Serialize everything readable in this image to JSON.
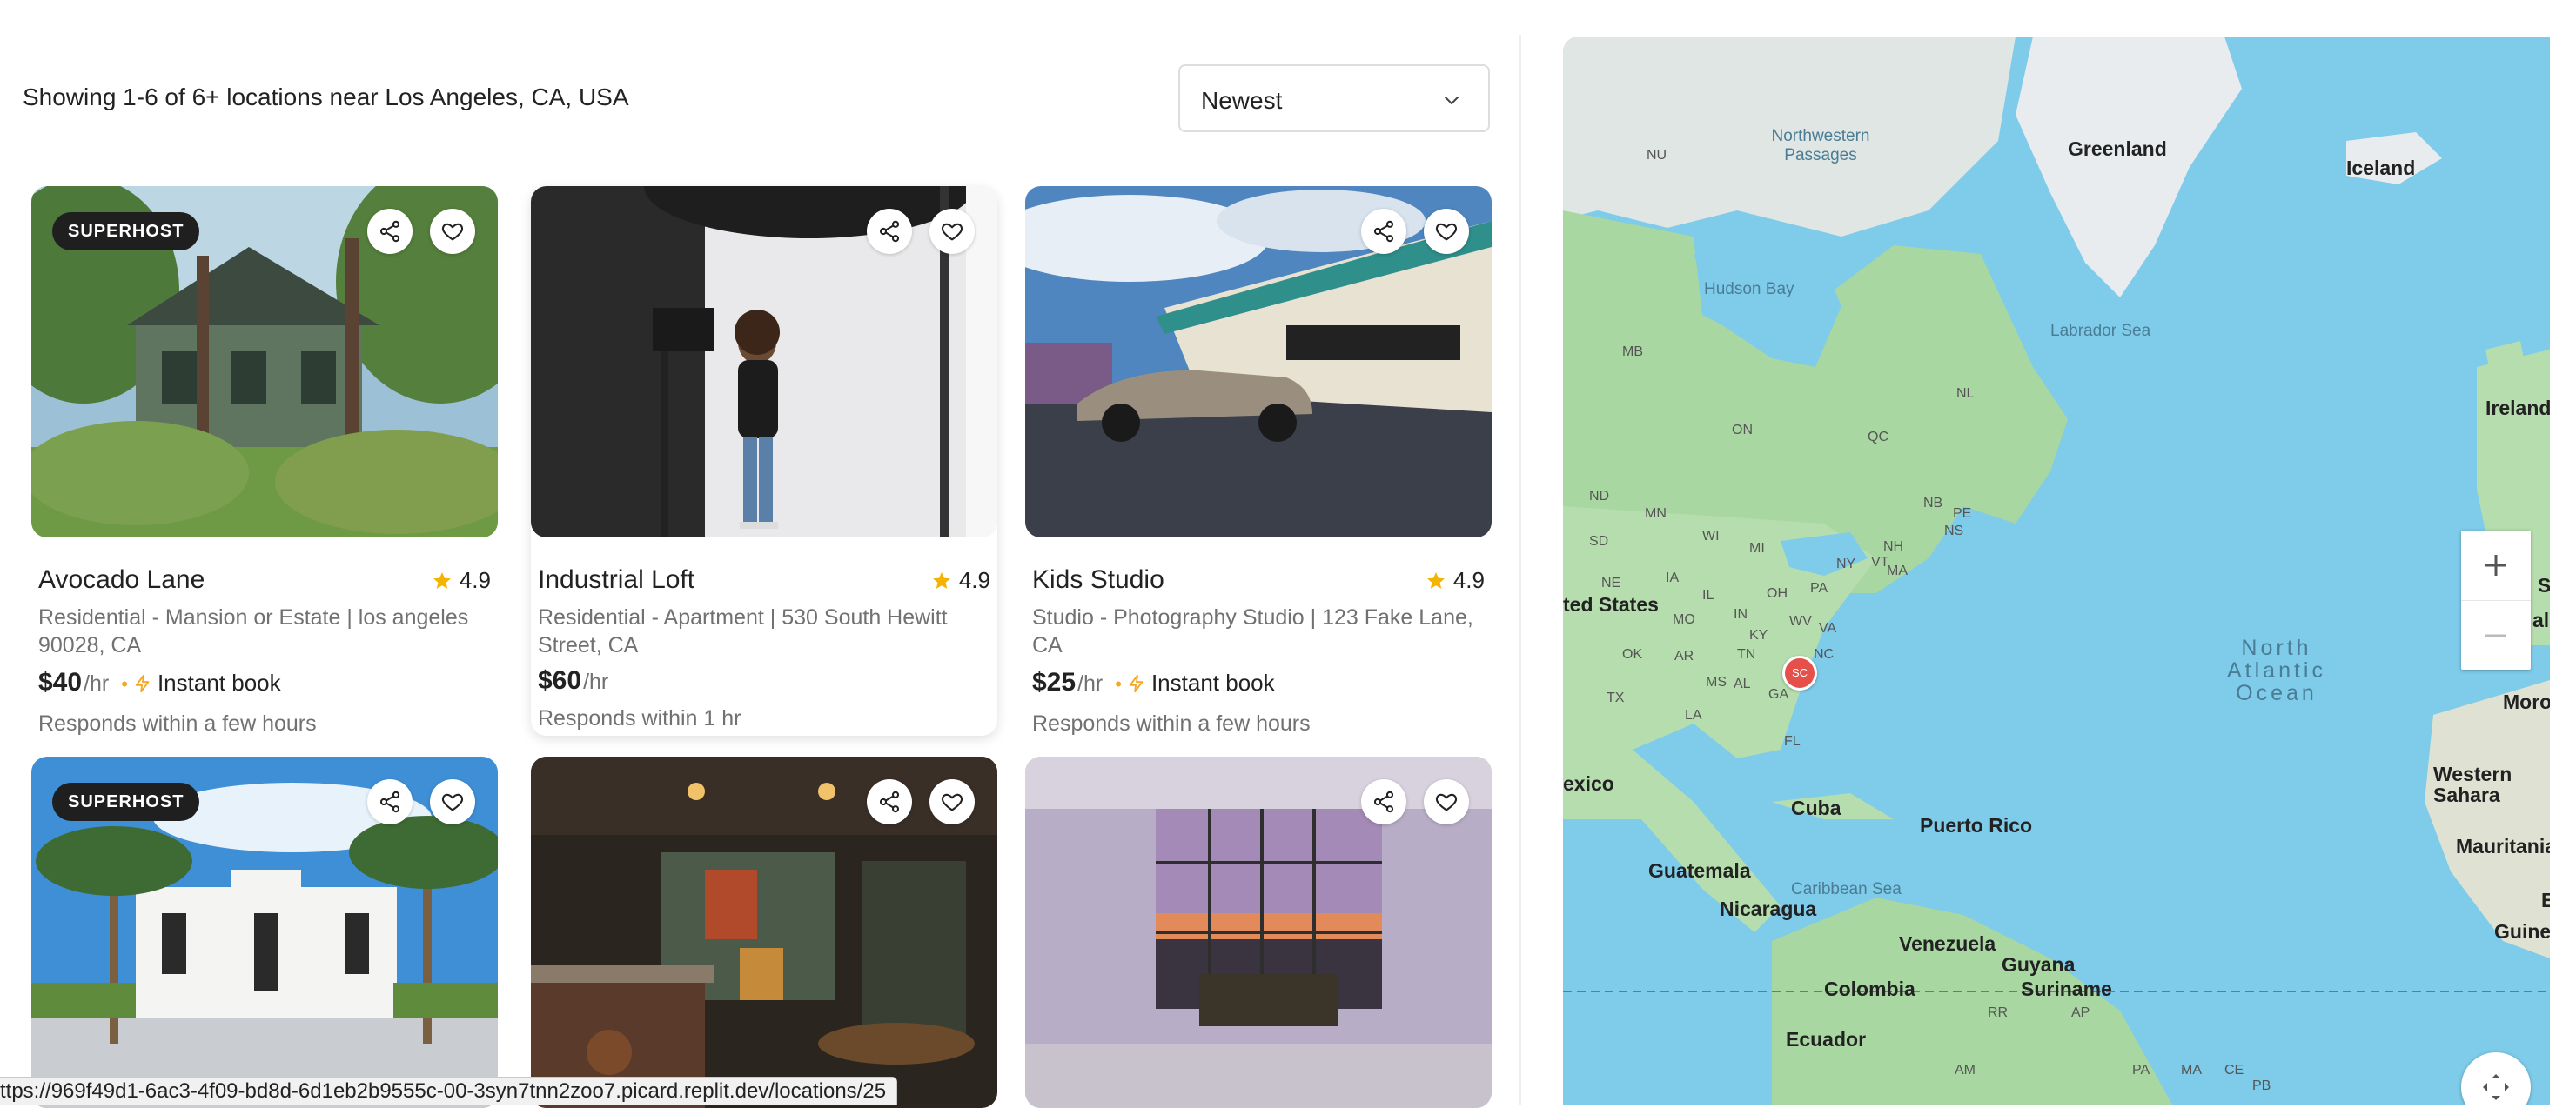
{
  "header": {
    "results_text": "Showing 1-6 of 6+ locations near Los Angeles, CA, USA",
    "sort": {
      "selected": "Newest"
    }
  },
  "listings": [
    {
      "badge": "SUPERHOST",
      "title": "Avocado Lane",
      "rating": "4.9",
      "description": "Residential - Mansion or Estate | los angeles 90028, CA",
      "price": "$40",
      "per": "/hr",
      "instant_book": "Instant book",
      "responds": "Responds within a few hours"
    },
    {
      "badge": "",
      "title": "Industrial Loft",
      "rating": "4.9",
      "description": "Residential - Apartment | 530 South Hewitt Street, CA",
      "price": "$60",
      "per": "/hr",
      "instant_book": "",
      "responds": "Responds within 1 hr"
    },
    {
      "badge": "",
      "title": "Kids Studio",
      "rating": "4.9",
      "description": "Studio - Photography Studio | 123 Fake Lane, CA",
      "price": "$25",
      "per": "/hr",
      "instant_book": "Instant book",
      "responds": "Responds within a few hours"
    },
    {
      "badge": "SUPERHOST"
    },
    {
      "badge": ""
    },
    {
      "badge": ""
    }
  ],
  "map": {
    "labels": {
      "greenland": "Greenland",
      "iceland": "Iceland",
      "ireland": "Ireland",
      "northwestern_passages": "Northwestern Passages",
      "hudson_bay": "Hudson Bay",
      "labrador_sea": "Labrador Sea",
      "nu": "NU",
      "mb": "MB",
      "on": "ON",
      "qc": "QC",
      "nl": "NL",
      "nb": "NB",
      "pe": "PE",
      "ns": "NS",
      "nd": "ND",
      "mn": "MN",
      "wi": "WI",
      "mi": "MI",
      "sd": "SD",
      "ne": "NE",
      "ia": "IA",
      "il": "IL",
      "oh": "OH",
      "pa": "PA",
      "ny": "NY",
      "vt": "VT",
      "nh": "NH",
      "ma": "MA",
      "in": "IN",
      "mo": "MO",
      "ky": "KY",
      "va": "VA",
      "wv": "WV",
      "nc": "NC",
      "ok": "OK",
      "ar": "AR",
      "tn": "TN",
      "ms": "MS",
      "al": "AL",
      "ga": "GA",
      "tx": "TX",
      "la": "LA",
      "fl": "FL",
      "united_states": "ted States",
      "north_atlantic_ocean": "North Atlantic Ocean",
      "mexico": "exico",
      "cuba": "Cuba",
      "puerto_rico": "Puerto Rico",
      "guatemala": "Guatemala",
      "nicaragua": "Nicaragua",
      "caribbean_sea": "Caribbean Sea",
      "venezuela": "Venezuela",
      "guyana": "Guyana",
      "suriname": "Suriname",
      "colombia": "Colombia",
      "ecuador": "Ecuador",
      "rr": "RR",
      "ap": "AP",
      "am": "AM",
      "pa2": "PA",
      "ma2": "MA",
      "ce": "CE",
      "pb": "PB",
      "western_sahara": "Western Sahara",
      "mauritania": "Mauritania",
      "guinea": "Guinea",
      "morocco": "Moroc",
      "spain_partial": "S",
      "portugal_partial": "al",
      "e_partial": "E"
    },
    "marker_label": "SC",
    "zoom_in": "+",
    "zoom_out": "−"
  },
  "status_bar": {
    "url": "ttps://969f49d1-6ac3-4f09-bd8d-6d1eb2b9555c-00-3syn7tnn2zoo7.picard.replit.dev/locations/25"
  },
  "colors": {
    "star": "#f5b301",
    "instant_bolt": "#f5a623",
    "map_water": "#7ecbea",
    "map_land": "#a8d9a1",
    "marker": "#e5504a"
  }
}
